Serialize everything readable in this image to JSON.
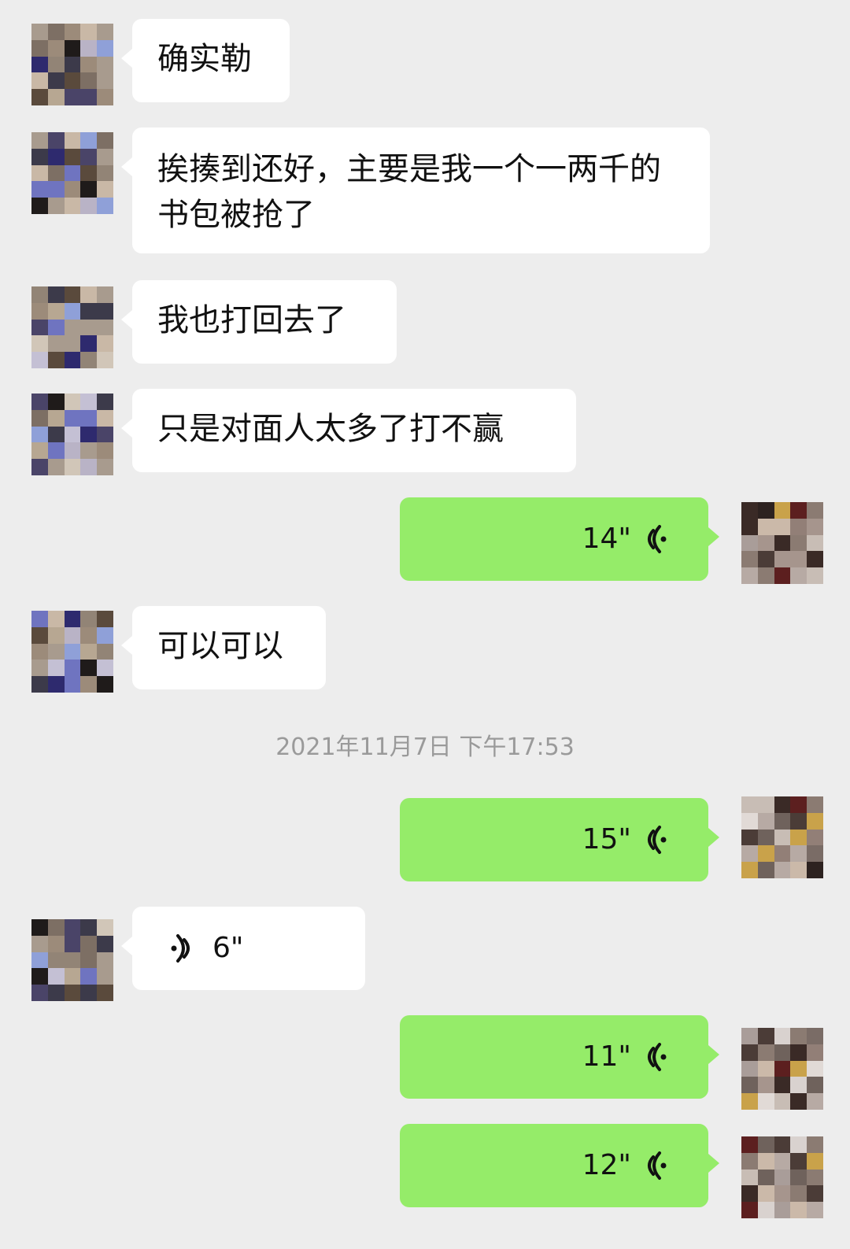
{
  "colors": {
    "background": "#ededed",
    "incoming_bubble": "#ffffff",
    "outgoing_bubble": "#95ec69",
    "timestamp_text": "#9a9a9a"
  },
  "messages": [
    {
      "direction": "incoming",
      "type": "text",
      "text": "确实勒"
    },
    {
      "direction": "incoming",
      "type": "text",
      "text": "挨揍到还好，主要是我一个一两千的书包被抢了"
    },
    {
      "direction": "incoming",
      "type": "text",
      "text": "我也打回去了"
    },
    {
      "direction": "incoming",
      "type": "text",
      "text": "只是对面人太多了打不赢"
    },
    {
      "direction": "outgoing",
      "type": "voice",
      "duration": "14\"",
      "icon": "voice-wave-icon"
    },
    {
      "direction": "incoming",
      "type": "text",
      "text": "可以可以"
    },
    {
      "direction": "outgoing",
      "type": "voice",
      "duration": "15\"",
      "icon": "voice-wave-icon"
    },
    {
      "direction": "incoming",
      "type": "voice",
      "duration": "6\"",
      "icon": "voice-wave-icon"
    },
    {
      "direction": "outgoing",
      "type": "voice",
      "duration": "11\"",
      "icon": "voice-wave-icon"
    },
    {
      "direction": "outgoing",
      "type": "voice",
      "duration": "12\"",
      "icon": "voice-wave-icon"
    }
  ],
  "timestamp": "2021年11月7日 下午17:53",
  "avatars": {
    "contact": "pixelated-contact-avatar",
    "self": "pixelated-self-avatar"
  }
}
